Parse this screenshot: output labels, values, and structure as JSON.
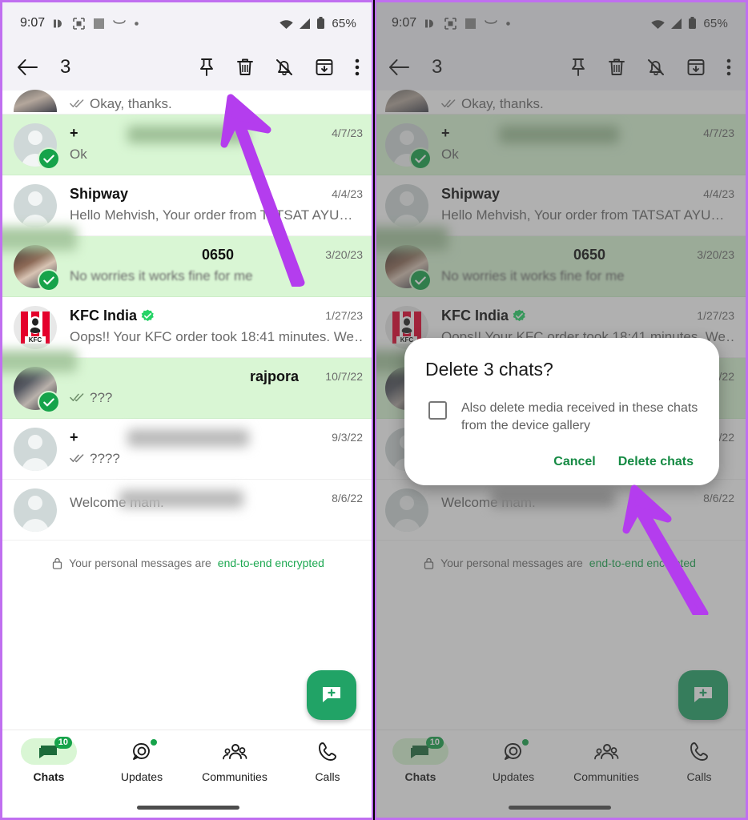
{
  "status_bar": {
    "time": "9:07",
    "battery": "65%",
    "icons": [
      "dnd-icon",
      "screenshot-icon",
      "square-icon",
      "curve-icon",
      "dot-icon",
      "wifi-icon",
      "signal-icon",
      "battery-icon"
    ]
  },
  "action_bar": {
    "back_label": "back-arrow",
    "selection_count": "3",
    "actions": [
      "pin-icon",
      "delete-icon",
      "mute-icon",
      "archive-icon",
      "overflow-menu-icon"
    ]
  },
  "chat_list": {
    "partial_row": {
      "preview": "Okay, thanks.",
      "ticks": true
    },
    "rows": [
      {
        "name": "",
        "name_blurred": true,
        "name_prefix": "+",
        "date": "4/7/23",
        "preview": "Ok",
        "selected": true,
        "ticks": false,
        "verified": false,
        "avatar": "placeholder"
      },
      {
        "name": "Shipway",
        "name_blurred": false,
        "name_prefix": "",
        "date": "4/4/23",
        "preview": "Hello Mehvish,   Your order from TATSAT AYU…",
        "selected": false,
        "ticks": false,
        "verified": false,
        "avatar": "placeholder"
      },
      {
        "name": "0650",
        "name_blurred": true,
        "name_prefix": "",
        "date": "3/20/23",
        "preview": "No worries it works fine for me",
        "selected": true,
        "ticks": false,
        "verified": false,
        "avatar": "photoA"
      },
      {
        "name": "KFC India",
        "name_blurred": false,
        "name_prefix": "",
        "date": "1/27/23",
        "preview": "Oops!! Your KFC order took 18:41 minutes. We…",
        "selected": false,
        "ticks": false,
        "verified": true,
        "avatar": "kfc"
      },
      {
        "name": "rajpora",
        "name_blurred": true,
        "name_prefix": "",
        "date": "10/7/22",
        "preview": "???",
        "selected": true,
        "ticks": true,
        "verified": false,
        "avatar": "photoB"
      },
      {
        "name": "",
        "name_blurred": true,
        "name_prefix": "+",
        "date": "9/3/22",
        "preview": "????",
        "selected": false,
        "ticks": true,
        "verified": false,
        "avatar": "placeholder"
      },
      {
        "name": "",
        "name_blurred": true,
        "name_prefix": "",
        "date": "8/6/22",
        "preview": "Welcome mam.",
        "selected": false,
        "ticks": false,
        "verified": false,
        "avatar": "placeholder"
      }
    ],
    "encryption_notice": {
      "prefix": "Your personal messages are",
      "link": "end-to-end encrypted",
      "icon": "lock-icon"
    }
  },
  "fab": {
    "icon": "new-chat-icon"
  },
  "bottom_nav": {
    "items": [
      {
        "label": "Chats",
        "icon": "chats-icon",
        "badge": "10",
        "dot": false,
        "active": true
      },
      {
        "label": "Updates",
        "icon": "updates-icon",
        "badge": "",
        "dot": true,
        "active": false
      },
      {
        "label": "Communities",
        "icon": "communities-icon",
        "badge": "",
        "dot": false,
        "active": false
      },
      {
        "label": "Calls",
        "icon": "calls-icon",
        "badge": "",
        "dot": false,
        "active": false
      }
    ]
  },
  "dialog": {
    "title": "Delete 3 chats?",
    "checkbox_label": "Also delete media received in these chats from the device gallery",
    "checkbox_checked": false,
    "cancel_label": "Cancel",
    "confirm_label": "Delete chats"
  },
  "annotations": {
    "arrow_color": "#b43dee",
    "arrow_left_target": "delete-icon",
    "arrow_right_target": "delete-chats-button"
  },
  "colors": {
    "accent_green": "#16a34a",
    "selected_row": "#d9f6d4",
    "fab_green": "#21a366",
    "link_green": "#1da851",
    "panel_border": "#c06ff0"
  }
}
